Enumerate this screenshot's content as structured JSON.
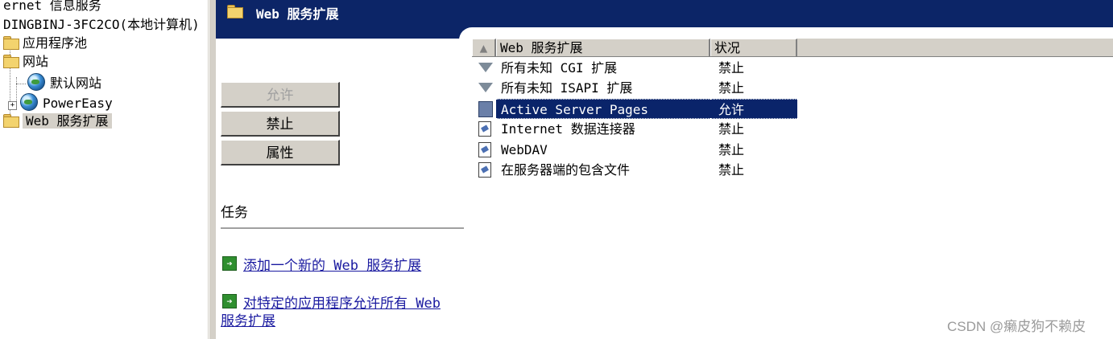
{
  "tree": {
    "root_partial": "ernet 信息服务",
    "computer": "DINGBINJ-3FC2CO(本地计算机)",
    "items": [
      {
        "label": "应用程序池"
      },
      {
        "label": "网站"
      },
      {
        "label": "默认网站"
      },
      {
        "label": "PowerEasy"
      },
      {
        "label": "Web 服务扩展"
      }
    ],
    "expand_symbol": "+"
  },
  "header": {
    "title": "Web 服务扩展"
  },
  "taskpad": {
    "buttons": {
      "allow": "允许",
      "prohibit": "禁止",
      "properties": "属性"
    },
    "tasks_title": "任务",
    "links": {
      "add_new": "添加一个新的 Web 服务扩展",
      "allow_all_line1": "对特定的应用程序允许所有 Web",
      "allow_all_line2": "服务扩展"
    }
  },
  "listview": {
    "columns": {
      "name": "Web 服务扩展",
      "status": "状况"
    },
    "sort_indicator": "▲",
    "rows": [
      {
        "name": "所有未知 CGI 扩展",
        "status": "禁止",
        "icon": "filter-icon"
      },
      {
        "name": "所有未知 ISAPI 扩展",
        "status": "禁止",
        "icon": "filter-icon"
      },
      {
        "name": "Active Server Pages",
        "status": "允许",
        "icon": "gear-icon",
        "selected": true
      },
      {
        "name": "Internet 数据连接器",
        "status": "禁止",
        "icon": "file-icon"
      },
      {
        "name": "WebDAV",
        "status": "禁止",
        "icon": "file-icon"
      },
      {
        "name": "在服务器端的包含文件",
        "status": "禁止",
        "icon": "file-icon"
      }
    ]
  },
  "watermark": "CSDN @癞皮狗不赖皮",
  "colors": {
    "header_bg": "#0c2567",
    "selection": "#0a246a",
    "link": "#1a1aa0"
  }
}
